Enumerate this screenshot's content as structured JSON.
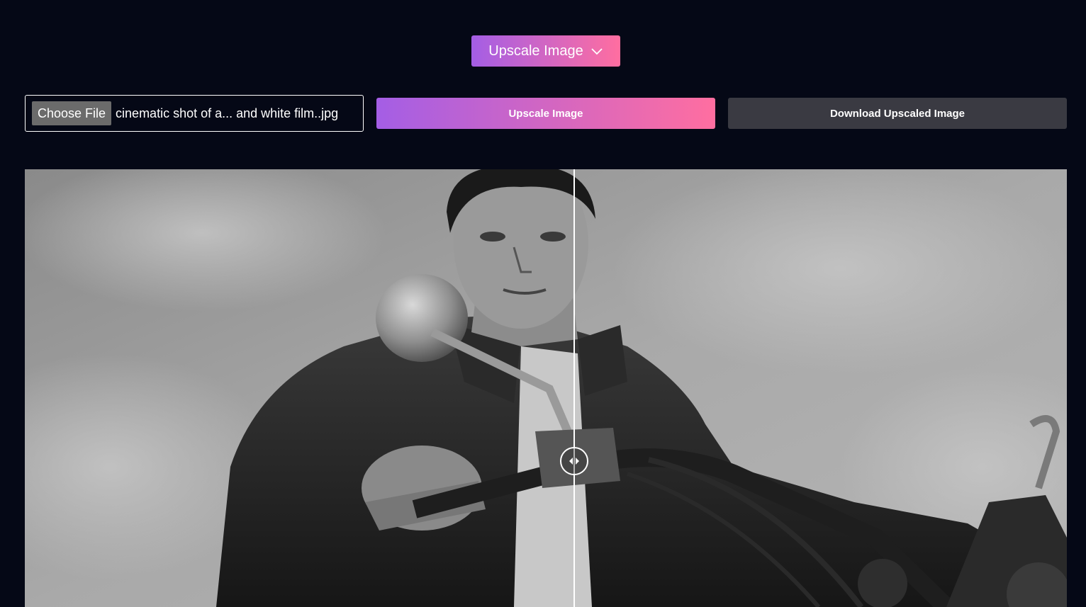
{
  "mode_selector": {
    "label": "Upscale Image",
    "icon": "chevron-down-icon"
  },
  "file_input": {
    "button_label": "Choose File",
    "file_name": "cinematic shot of a... and white film..jpg"
  },
  "actions": {
    "upscale_label": "Upscale Image",
    "download_label": "Download Upscaled Image"
  },
  "comparison": {
    "slider_position": 0.527,
    "handle_icon": "left-right-arrows-icon"
  },
  "colors": {
    "background": "#050816",
    "gradient_start": "#a45ee5",
    "gradient_end": "#ff6ea0",
    "secondary_button": "#3a3a42"
  }
}
